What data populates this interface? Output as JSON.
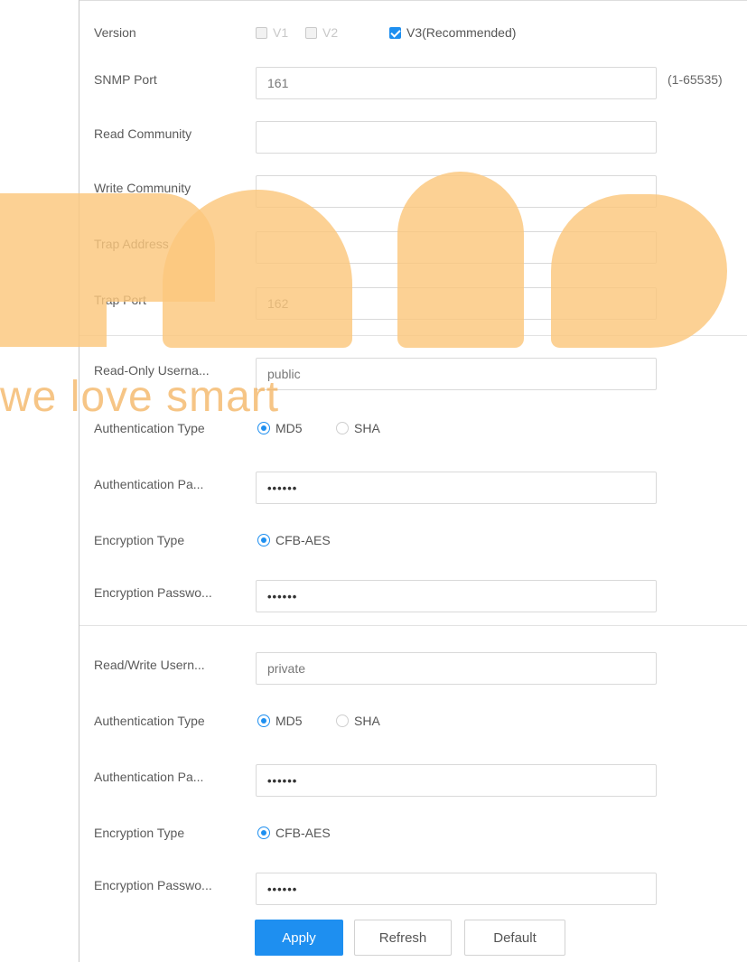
{
  "version": {
    "label": "Version",
    "options": [
      {
        "text": "V1",
        "checked": false,
        "enabled": false
      },
      {
        "text": "V2",
        "checked": false,
        "enabled": false
      },
      {
        "text": "V3(Recommended)",
        "checked": true,
        "enabled": true
      }
    ]
  },
  "snmp_port": {
    "label": "SNMP Port",
    "value": "161",
    "hint": "(1-65535)"
  },
  "read_community": {
    "label": "Read Community",
    "value": ""
  },
  "write_community": {
    "label": "Write Community",
    "value": ""
  },
  "trap_address": {
    "label": "Trap Address",
    "value": ""
  },
  "trap_port": {
    "label": "Trap Port",
    "value": "162"
  },
  "read_only": {
    "username_label": "Read-Only Userna...",
    "username_value": "public",
    "auth_type_label": "Authentication Type",
    "auth_options": [
      "MD5",
      "SHA"
    ],
    "auth_selected": "MD5",
    "auth_password_label": "Authentication Pa...",
    "auth_password_value": "••••••",
    "enc_type_label": "Encryption Type",
    "enc_option": "CFB-AES",
    "enc_password_label": "Encryption Passwo...",
    "enc_password_value": "••••••"
  },
  "read_write": {
    "username_label": "Read/Write Usern...",
    "username_value": "private",
    "auth_type_label": "Authentication Type",
    "auth_options": [
      "MD5",
      "SHA"
    ],
    "auth_selected": "MD5",
    "auth_password_label": "Authentication Pa...",
    "auth_password_value": "••••••",
    "enc_type_label": "Encryption Type",
    "enc_option": "CFB-AES",
    "enc_password_label": "Encryption Passwo...",
    "enc_password_value": "••••••"
  },
  "buttons": {
    "apply": "Apply",
    "refresh": "Refresh",
    "default": "Default"
  },
  "watermark": {
    "text": "we love smart",
    "color": "#fbc77c"
  },
  "colors": {
    "accent": "#1e8ff0"
  }
}
